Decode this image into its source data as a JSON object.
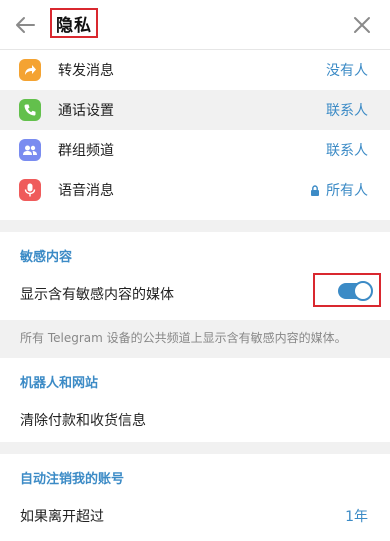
{
  "header": {
    "title": "隐私"
  },
  "privacy_items": [
    {
      "label": "转发消息",
      "value": "没有人",
      "icon": "forward-icon",
      "color": "#f4a332"
    },
    {
      "label": "通话设置",
      "value": "联系人",
      "icon": "phone-icon",
      "color": "#63c04c"
    },
    {
      "label": "群组频道",
      "value": "联系人",
      "icon": "group-icon",
      "color": "#7a8cf0"
    },
    {
      "label": "语音消息",
      "value": "所有人",
      "icon": "microphone-icon",
      "color": "#ef5b5b",
      "locked": true
    }
  ],
  "sensitive": {
    "title": "敏感内容",
    "toggle_label": "显示含有敏感内容的媒体",
    "toggle_on": true,
    "note": "所有 Telegram 设备的公共频道上显示含有敏感内容的媒体。"
  },
  "bots": {
    "title": "机器人和网站",
    "item": "清除付款和收货信息"
  },
  "auto_delete": {
    "title": "自动注销我的账号",
    "item": "如果离开超过",
    "value": "1年"
  },
  "colors": {
    "accent": "#3c8bc6",
    "highlight_box": "#d9282f"
  }
}
